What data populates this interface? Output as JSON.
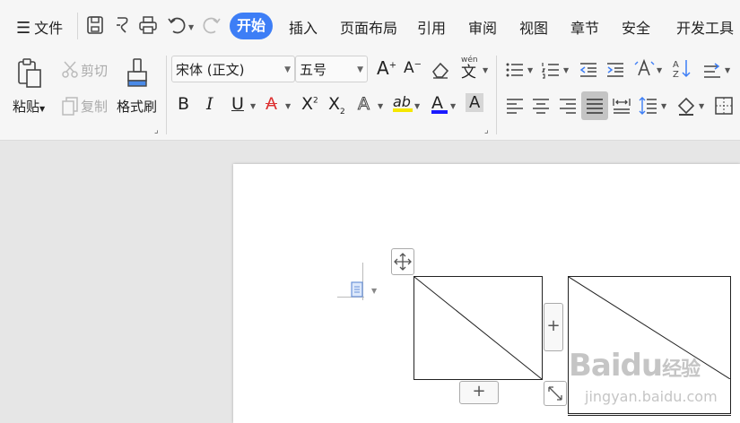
{
  "menu": {
    "file": "文件",
    "tabs": [
      "开始",
      "插入",
      "页面布局",
      "引用",
      "审阅",
      "视图",
      "章节",
      "安全",
      "开发工具"
    ]
  },
  "clipboard": {
    "paste": "粘贴",
    "cut": "剪切",
    "copy": "复制",
    "format_painter": "格式刷"
  },
  "font": {
    "family": "宋体 (正文)",
    "size": "五号",
    "bold": "B",
    "italic": "I",
    "underline": "U",
    "strike": "A",
    "superscript": "X",
    "subscript": "X",
    "outline": "A",
    "highlight": "ab",
    "font_color": "A",
    "char_shading": "A",
    "phonetic": "wén",
    "phonetic_char": "文",
    "grow": "A",
    "shrink": "A"
  },
  "table": {
    "add_column": "+",
    "add_row": "+"
  },
  "watermark": {
    "brand": "Baidu",
    "brand_cn": "经验",
    "url": "jingyan.baidu.com"
  },
  "colors": {
    "accent": "#3d7ef6",
    "highlight_bar": "#f5e700",
    "font_color_bar": "#1a1aff"
  }
}
